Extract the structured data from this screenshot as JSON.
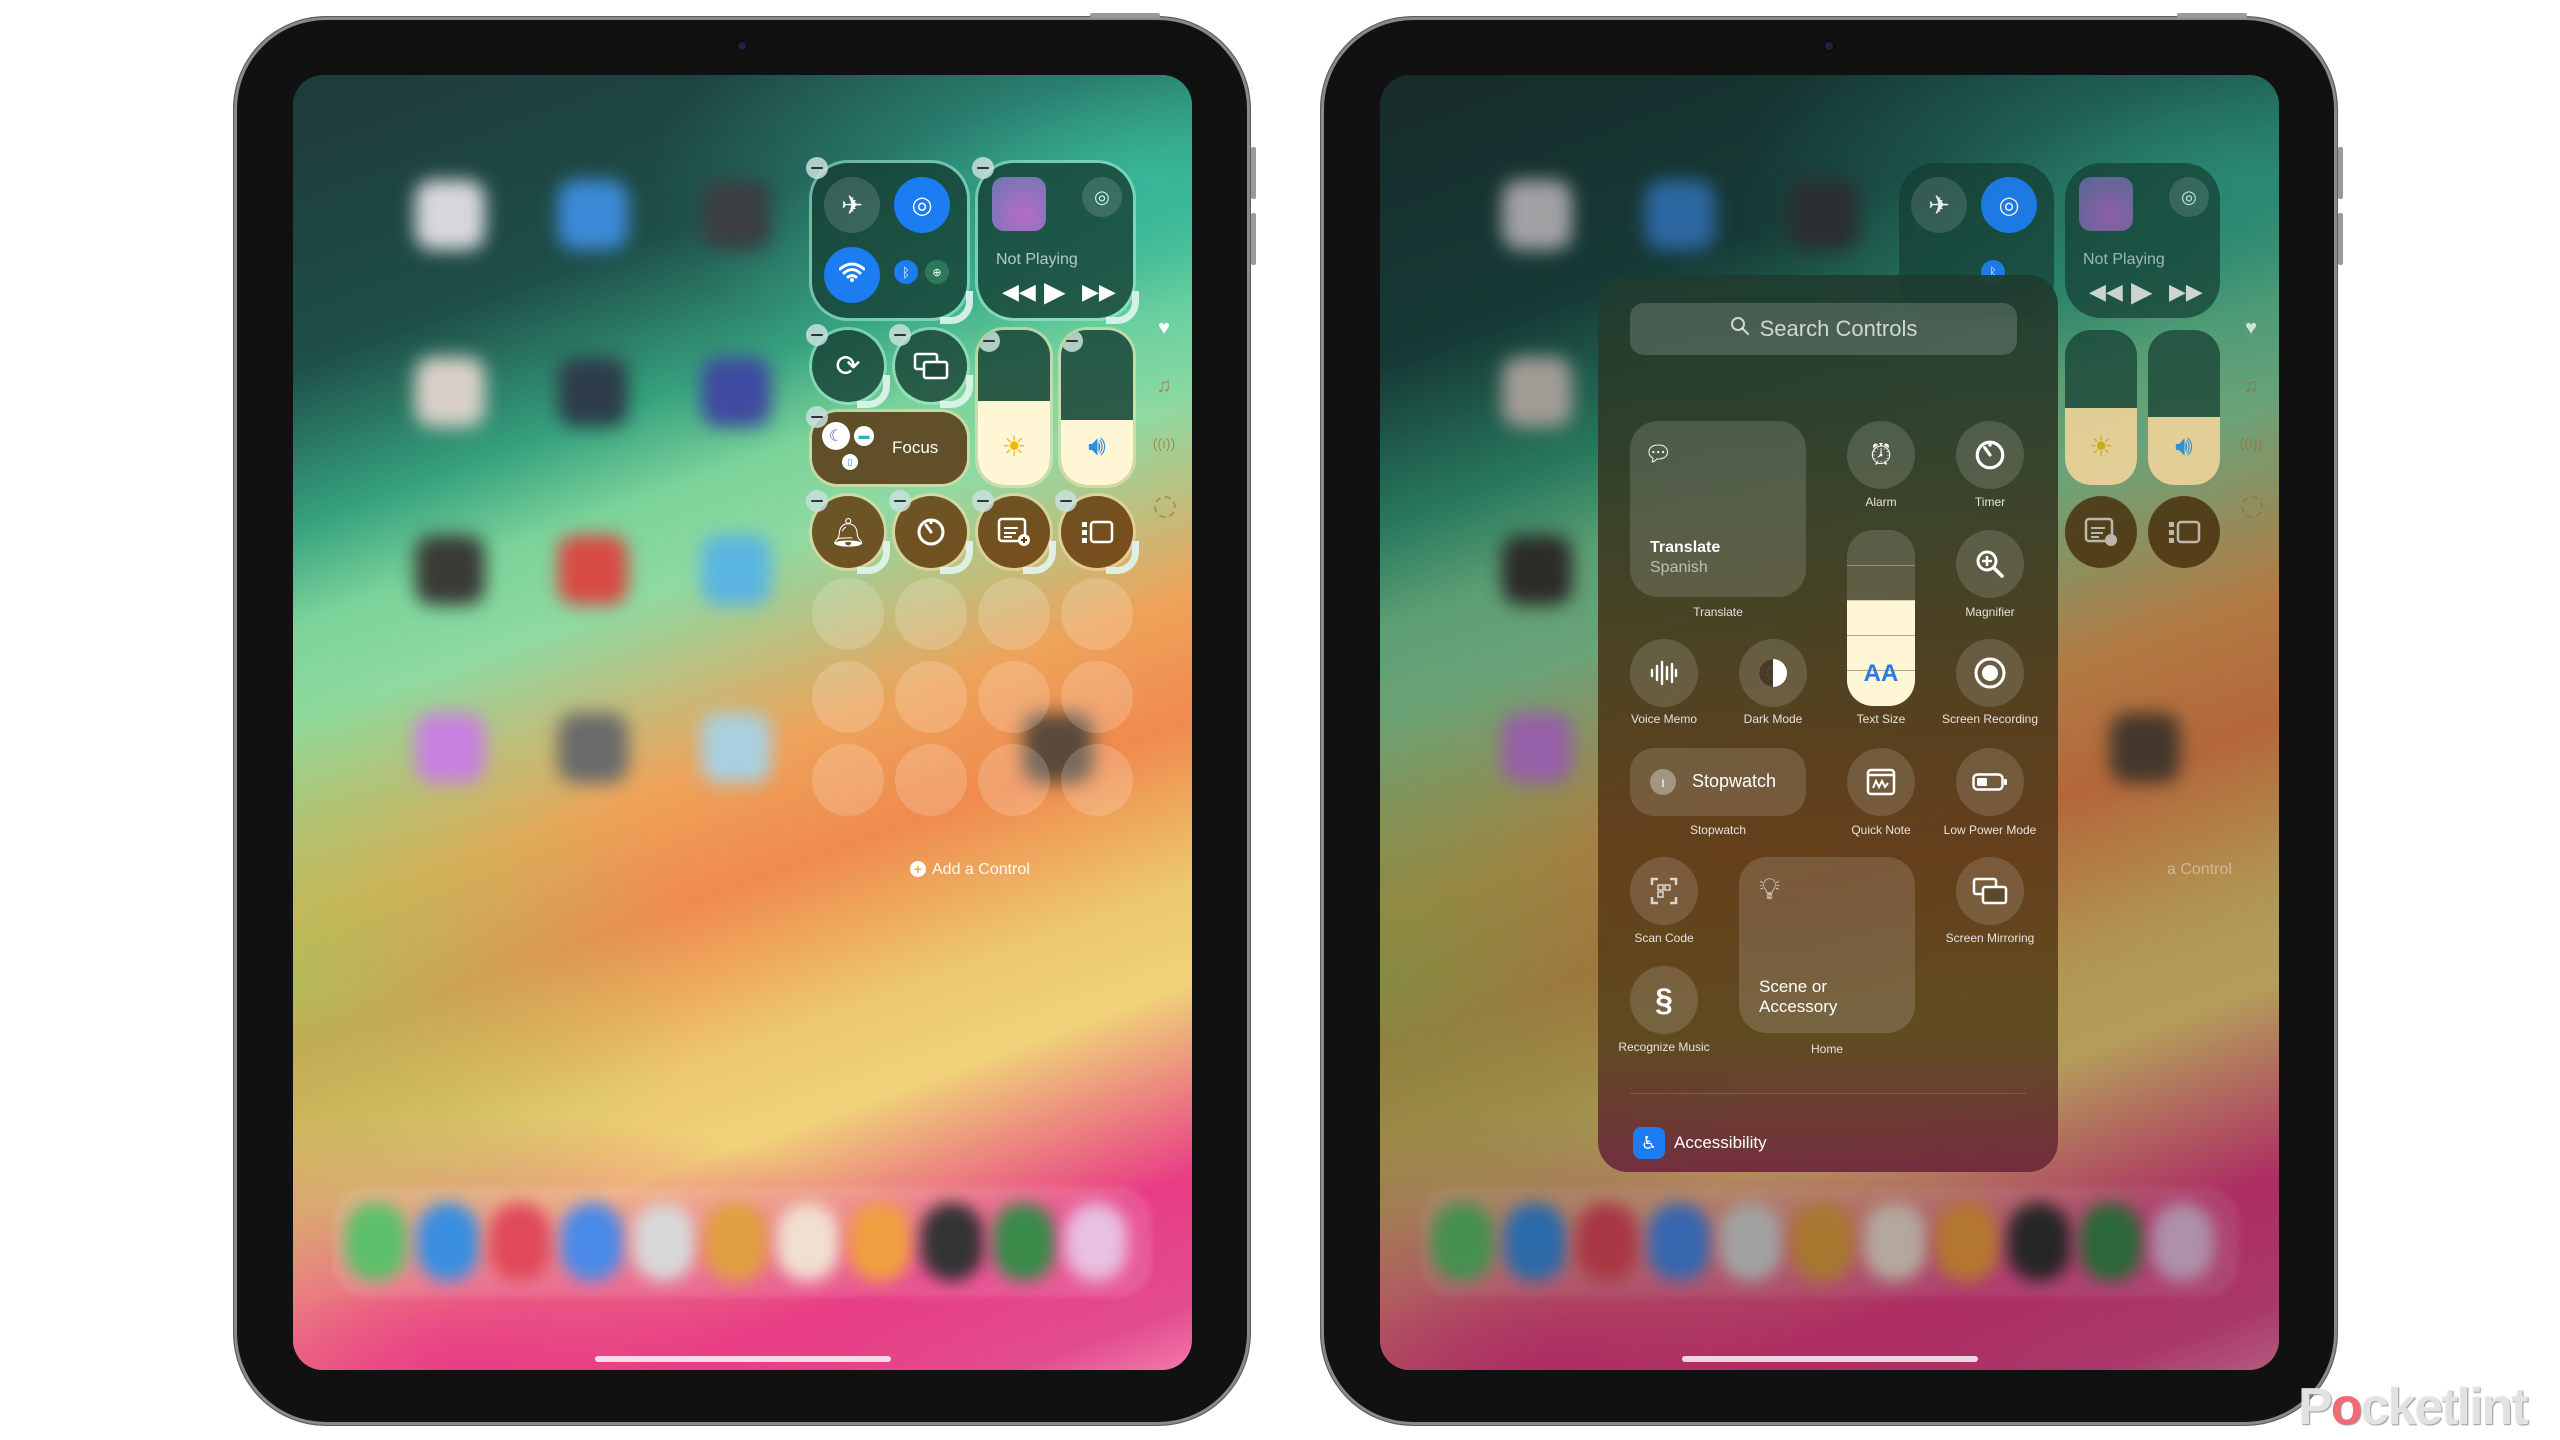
{
  "left_ipad": {
    "control_center": {
      "connectivity": {
        "airplane_mode": {
          "icon": "airplane-icon",
          "on": false
        },
        "airdrop": {
          "icon": "airdrop-icon",
          "on": true
        },
        "wifi": {
          "icon": "wifi-icon",
          "on": true
        },
        "bluetooth": {
          "icon": "bluetooth-icon",
          "on": true
        },
        "cellular": {
          "icon": "cellular-icon",
          "on": false
        }
      },
      "now_playing": {
        "status": "Not Playing",
        "airplay_icon": "airplay-icon"
      },
      "rotation_lock_icon": "rotation-lock-icon",
      "screen_mirroring_icon": "screen-mirroring-icon",
      "focus": {
        "label": "Focus"
      },
      "brightness": {
        "level_percent": 54
      },
      "volume": {
        "level_percent": 42
      },
      "bottom_row": [
        {
          "name": "silent-mode",
          "icon": "bell-icon"
        },
        {
          "name": "timer",
          "icon": "timer-icon"
        },
        {
          "name": "quick-note",
          "icon": "quick-note-icon"
        },
        {
          "name": "stage-manager",
          "icon": "stage-manager-icon"
        }
      ],
      "add_control_label": "Add a Control",
      "side_page_icons": [
        "heart-icon",
        "music-icon",
        "antenna-icon",
        "dashed-circle-icon"
      ]
    }
  },
  "right_ipad": {
    "now_playing": {
      "status": "Not Playing"
    },
    "brightness": {
      "level_percent": 50
    },
    "volume": {
      "level_percent": 44
    },
    "add_control_faded_label": "a Control",
    "add_controls_panel": {
      "search_placeholder": "Search Controls",
      "controls": {
        "translate": {
          "title": "Translate",
          "subtitle": "Spanish",
          "caption": "Translate"
        },
        "alarm": {
          "caption": "Alarm"
        },
        "timer": {
          "caption": "Timer"
        },
        "magnifier": {
          "caption": "Magnifier"
        },
        "text_size": {
          "caption": "Text Size",
          "glyph": "AA",
          "level_steps": 3,
          "total_steps": 5
        },
        "voice_memo": {
          "caption": "Voice Memo"
        },
        "dark_mode": {
          "caption": "Dark Mode"
        },
        "screen_recording": {
          "caption": "Screen Recording"
        },
        "stopwatch": {
          "title": "Stopwatch",
          "caption": "Stopwatch"
        },
        "quick_note": {
          "caption": "Quick Note"
        },
        "low_power_mode": {
          "caption": "Low Power Mode"
        },
        "scan_code": {
          "caption": "Scan Code"
        },
        "home": {
          "title": "Scene or Accessory",
          "caption": "Home"
        },
        "screen_mirroring": {
          "caption": "Screen Mirroring"
        },
        "recognize_music": {
          "caption": "Recognize Music"
        }
      },
      "section": {
        "label": "Accessibility"
      }
    }
  },
  "watermark": {
    "pre": "P",
    "o": "o",
    "post": "cketlint"
  }
}
